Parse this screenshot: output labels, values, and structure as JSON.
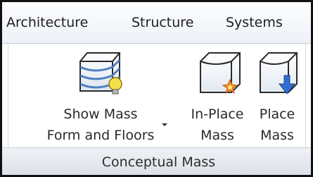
{
  "ribbon": {
    "tabs": [
      "Architecture",
      "Structure",
      "Systems"
    ]
  },
  "panel": {
    "title": "Conceptual Mass",
    "buttons": {
      "show_mass": {
        "line1": "Show Mass",
        "line2": "Form and Floors",
        "icon": "mass-floors-lightbulb-icon"
      },
      "inplace_mass": {
        "line1": "In-Place",
        "line2": "Mass",
        "icon": "mass-sparkle-icon"
      },
      "place_mass": {
        "line1": "Place",
        "line2": "Mass",
        "icon": "mass-down-arrow-icon"
      }
    }
  },
  "colors": {
    "icon_blue": "#4f7fbf",
    "arrow_blue": "#2f6fd1",
    "bulb_yellow": "#f4e14a",
    "sparkle_orange": "#f29a22"
  }
}
